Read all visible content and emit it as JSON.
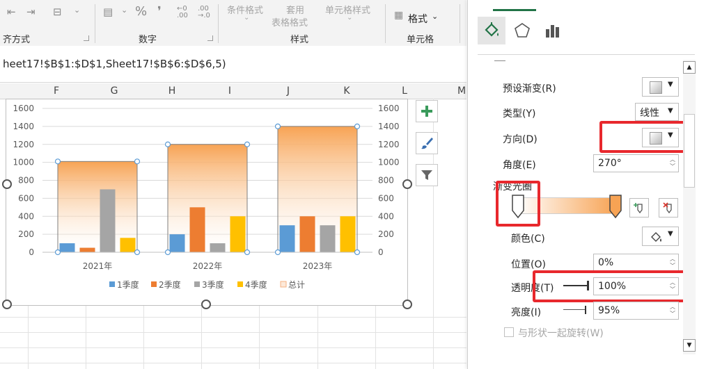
{
  "ribbon": {
    "align_label": "齐方式",
    "number_label": "数字",
    "styles_label": "样式",
    "cells_label": "单元格",
    "percent_symbol": "%",
    "comma_symbol": "❜",
    "cond_format": "条件格式",
    "table_format_l1": "套用",
    "table_format_l2": "表格格式",
    "cell_styles": "单元格样式",
    "format_label": "格式"
  },
  "formula": "heet17!$B$1:$D$1,Sheet17!$B$6:$D$6,5)",
  "columns": [
    "F",
    "G",
    "H",
    "I",
    "J",
    "K",
    "L",
    "M"
  ],
  "chart_data": {
    "type": "bar",
    "categories": [
      "2021年",
      "2022年",
      "2023年"
    ],
    "series": [
      {
        "name": "1季度",
        "color": "#5b9bd5",
        "values": [
          100,
          200,
          300
        ]
      },
      {
        "name": "2季度",
        "color": "#ed7d31",
        "values": [
          50,
          500,
          400
        ]
      },
      {
        "name": "3季度",
        "color": "#a5a5a5",
        "values": [
          700,
          100,
          300
        ]
      },
      {
        "name": "4季度",
        "color": "#ffc000",
        "values": [
          160,
          400,
          400
        ]
      },
      {
        "name": "总计",
        "color": "#f4b183",
        "values": [
          1010,
          1200,
          1400
        ]
      }
    ],
    "ylim": [
      0,
      1600
    ],
    "yticks": [
      "1600",
      "1400",
      "1200",
      "1000",
      "800",
      "600",
      "400",
      "200",
      "0"
    ],
    "y2ticks": [
      "1600",
      "1400",
      "1200",
      "1000",
      "800",
      "600",
      "400",
      "200",
      "0"
    ],
    "legend_position": "bottom",
    "grid": true
  },
  "panel": {
    "preset_gradient": "预设渐变(R)",
    "type_label": "类型(Y)",
    "type_value": "线性",
    "direction_label": "方向(D)",
    "angle_label": "角度(E)",
    "angle_value": "270°",
    "gradient_stops_label": "渐变光圈",
    "color_label": "颜色(C)",
    "position_label": "位置(O)",
    "position_value": "0%",
    "transparency_label": "透明度(T)",
    "transparency_value": "100%",
    "brightness_label": "亮度(I)",
    "brightness_value": "95%",
    "rotate_label": "与形状一起旋转(W)",
    "tab_fill_icon": "fill-bucket-icon",
    "tab_effects_icon": "pentagon-icon",
    "tab_bar_icon": "bar-chart-icon"
  }
}
